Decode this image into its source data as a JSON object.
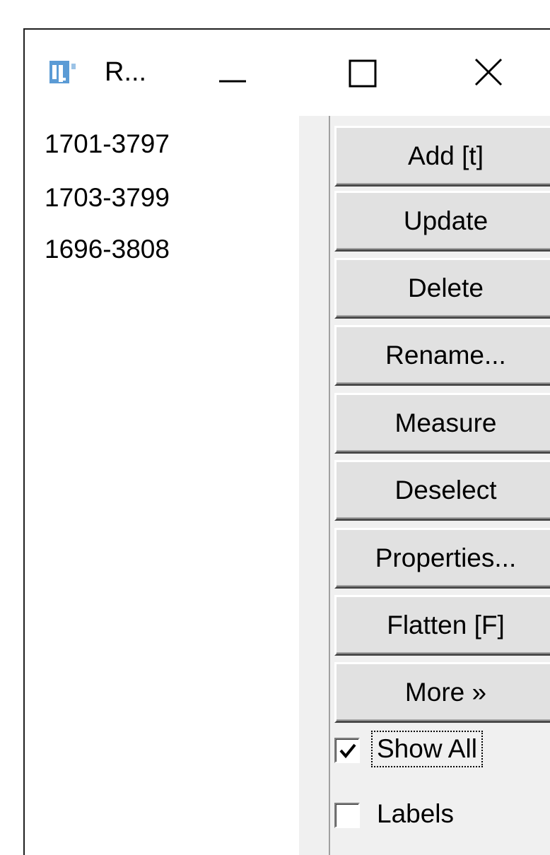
{
  "window": {
    "title": "R...",
    "icon": "imagej-icon",
    "controls": {
      "minimize": "minimize-icon",
      "maximize": "maximize-icon",
      "close": "close-icon"
    }
  },
  "roi_list": {
    "items": [
      "1701-3797",
      "1703-3799",
      "1696-3808"
    ]
  },
  "buttons": [
    {
      "label": "Add [t]"
    },
    {
      "label": "Update"
    },
    {
      "label": "Delete"
    },
    {
      "label": "Rename..."
    },
    {
      "label": "Measure"
    },
    {
      "label": "Deselect"
    },
    {
      "label": "Properties..."
    },
    {
      "label": "Flatten [F]"
    },
    {
      "label": "More »"
    }
  ],
  "checkboxes": [
    {
      "label": "Show All",
      "checked": true
    },
    {
      "label": "Labels",
      "checked": false
    }
  ],
  "colors": {
    "button_face": "#e1e1e1",
    "panel_bg": "#f0f0f0",
    "icon_blue": "#5b9bd5"
  }
}
